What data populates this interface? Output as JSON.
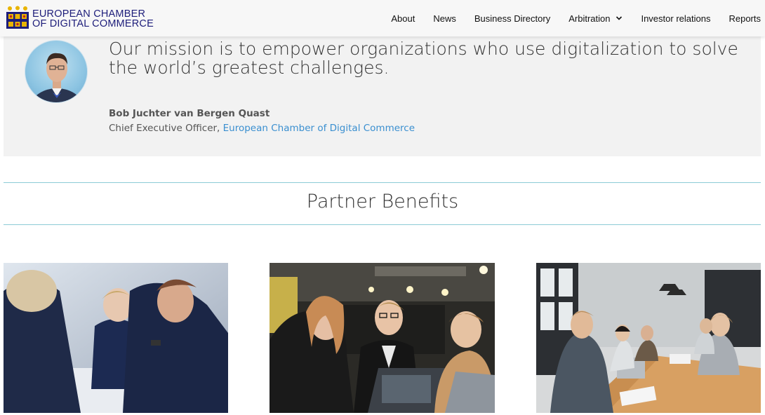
{
  "header": {
    "logo_line1": "EUROPEAN CHAMBER",
    "logo_line2": "OF DIGITAL COMMERCE",
    "nav": [
      {
        "label": "About"
      },
      {
        "label": "News"
      },
      {
        "label": "Business Directory"
      },
      {
        "label": "Arbitration"
      },
      {
        "label": "Investor relations"
      },
      {
        "label": "Reports"
      }
    ]
  },
  "mission": {
    "quote": "Our mission is to empower organizations who use digitalization to solve the world’s greatest challenges.",
    "author": "Bob Juchter van Bergen Quast",
    "role_prefix": "Chief Executive Officer, ",
    "role_link": "European Chamber of Digital Commerce"
  },
  "benefits": {
    "title": "Partner Benefits"
  },
  "colors": {
    "brand_blue": "#1d1d7a",
    "logo_gold": "#e8b400",
    "link": "#3a8fd0",
    "rule": "#8ccbd6",
    "mission_bg": "#f2f2f2"
  },
  "icons": {
    "logo": "chamber-logo-icon",
    "arbitration_dropdown": "chevron-down-icon"
  }
}
